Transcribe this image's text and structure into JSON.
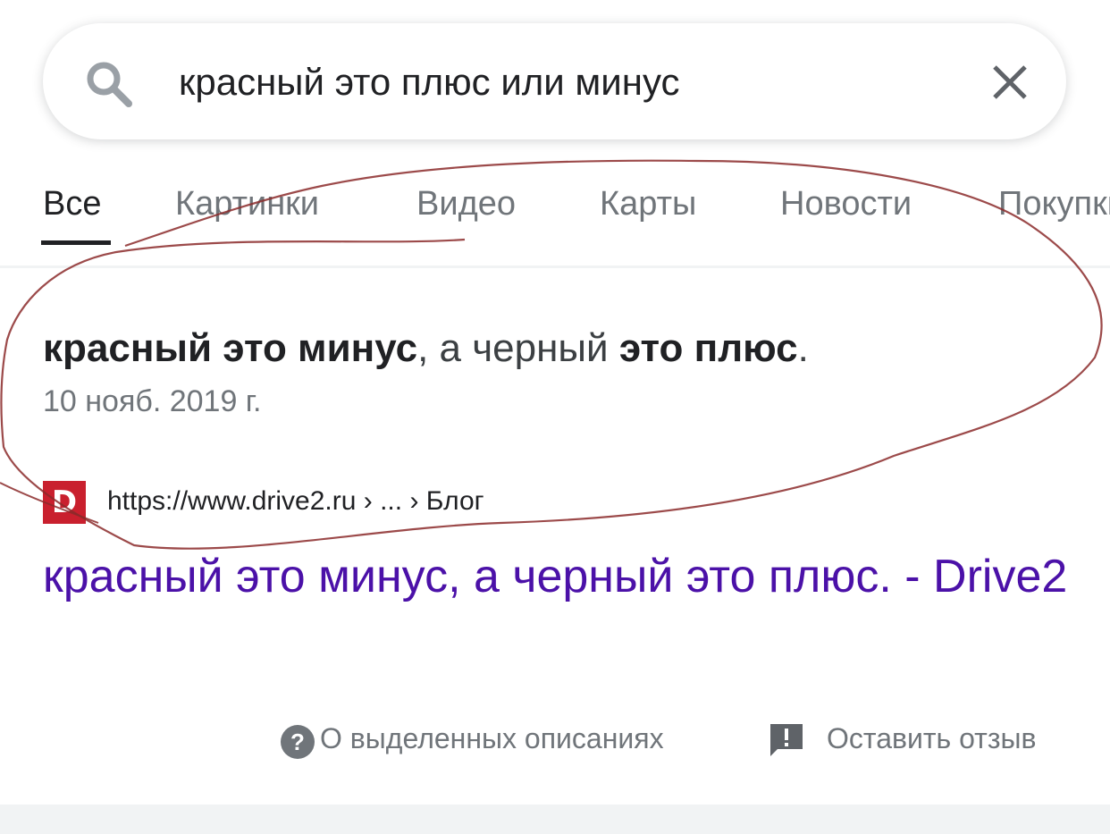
{
  "search": {
    "query": "красный это плюс или минус",
    "icon": "search-icon",
    "clear_icon": "close-icon"
  },
  "tabs": [
    {
      "label": "Все",
      "active": true
    },
    {
      "label": "Картинки",
      "active": false
    },
    {
      "label": "Видео",
      "active": false
    },
    {
      "label": "Карты",
      "active": false
    },
    {
      "label": "Новости",
      "active": false
    },
    {
      "label": "Покупки",
      "active": false
    }
  ],
  "featured_snippet": {
    "bold_1": "красный это минус",
    "text_1": ", а черный ",
    "bold_2": "это плюс",
    "text_2": ".",
    "date": "10 нояб. 2019 г."
  },
  "source": {
    "favicon_letter": "D",
    "url": "https://www.drive2.ru › ... › Блог"
  },
  "result": {
    "title": "красный это минус, а черный это плюс. - Drive2"
  },
  "footer": {
    "about_label": "О выделенных описаниях",
    "feedback_label": "Оставить отзыв"
  },
  "colors": {
    "link_visited": "#4b11a8",
    "favicon_bg": "#c9202e",
    "annotation_stroke": "#8b2a2a"
  }
}
